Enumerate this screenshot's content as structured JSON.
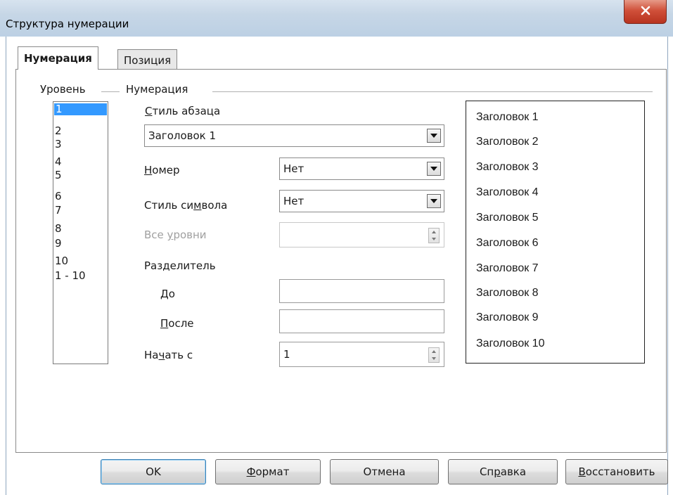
{
  "window": {
    "title": "Структура нумерации"
  },
  "tabs": [
    {
      "label": "Нумерация",
      "active": true
    },
    {
      "label": "Позиция",
      "active": false
    }
  ],
  "level_group": {
    "label": "Уровень",
    "items": [
      "1",
      "2",
      "3",
      "4",
      "5",
      "6",
      "7",
      "8",
      "9",
      "10",
      "1 - 10"
    ],
    "selected": "1"
  },
  "numbering_group": {
    "label": "Нумерация",
    "paragraph_style": {
      "label": "Стиль абзаца",
      "value": "Заголовок 1"
    },
    "number": {
      "label": "Номер",
      "value": "Нет"
    },
    "char_style": {
      "label": "Стиль символа",
      "value": "Нет"
    },
    "all_levels": {
      "label": "Все уровни",
      "value": ""
    },
    "separator": {
      "label": "Разделитель"
    },
    "before": {
      "label": "До",
      "value": ""
    },
    "after": {
      "label": "После",
      "value": ""
    },
    "start_at": {
      "label": "Начать с",
      "value": "1"
    }
  },
  "preview": {
    "items": [
      "Заголовок 1",
      "Заголовок 2",
      "Заголовок 3",
      "Заголовок 4",
      "Заголовок 5",
      "Заголовок 6",
      "Заголовок 7",
      "Заголовок 8",
      "Заголовок 9",
      "Заголовок 10"
    ]
  },
  "buttons": {
    "ok": "OK",
    "format": "Формат",
    "cancel": "Отмена",
    "help": "Справка",
    "reset": "Восстановить"
  },
  "colors": {
    "selection": "#3399ff",
    "titlebar": "#c6d6e6",
    "close_button": "#d0503a"
  }
}
